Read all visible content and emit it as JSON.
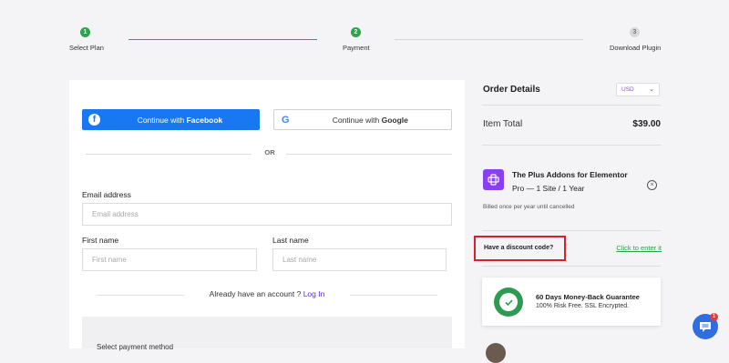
{
  "stepper": {
    "steps": [
      {
        "number": "1",
        "label": "Select Plan",
        "status": "done"
      },
      {
        "number": "2",
        "label": "Payment",
        "status": "current"
      },
      {
        "number": "3",
        "label": "Download Plugin",
        "status": "todo"
      }
    ],
    "colors": {
      "done": "#2da34c",
      "todo": "#d8d8dc"
    }
  },
  "social": {
    "facebook_prefix": "Continue with ",
    "facebook_brand": "Facebook",
    "google_prefix": "Continue with ",
    "google_brand": "Google",
    "divider_text": "OR"
  },
  "form": {
    "email_label": "Email address",
    "email_placeholder": "Email address",
    "first_name_label": "First name",
    "first_name_placeholder": "First name",
    "last_name_label": "Last name",
    "last_name_placeholder": "Last name",
    "login_prompt": "Already have an account ? ",
    "login_link": "Log In",
    "payment_method_label": "Select payment method"
  },
  "order": {
    "title": "Order Details",
    "currency": "USD",
    "item_total_label": "Item Total",
    "item_total_value": "$39.00",
    "product_name": "The Plus Addons for Elementor",
    "product_plan": "Pro — 1 Site / 1 Year",
    "billing_note": "Billed once per year until cancelled",
    "discount_label": "Have a discount code?",
    "discount_link": "Click to enter it",
    "guarantee_title": "60 Days Money-Back Guarantee",
    "guarantee_subtitle": "100% Risk Free. SSL Encrypted."
  },
  "chat": {
    "badge_count": "1"
  },
  "colors": {
    "facebook": "#1877f2",
    "accent_purple": "#5b2ad6",
    "success_green": "#2aa048",
    "highlight_red": "#d9202e",
    "chat_blue": "#2f6ee0"
  }
}
